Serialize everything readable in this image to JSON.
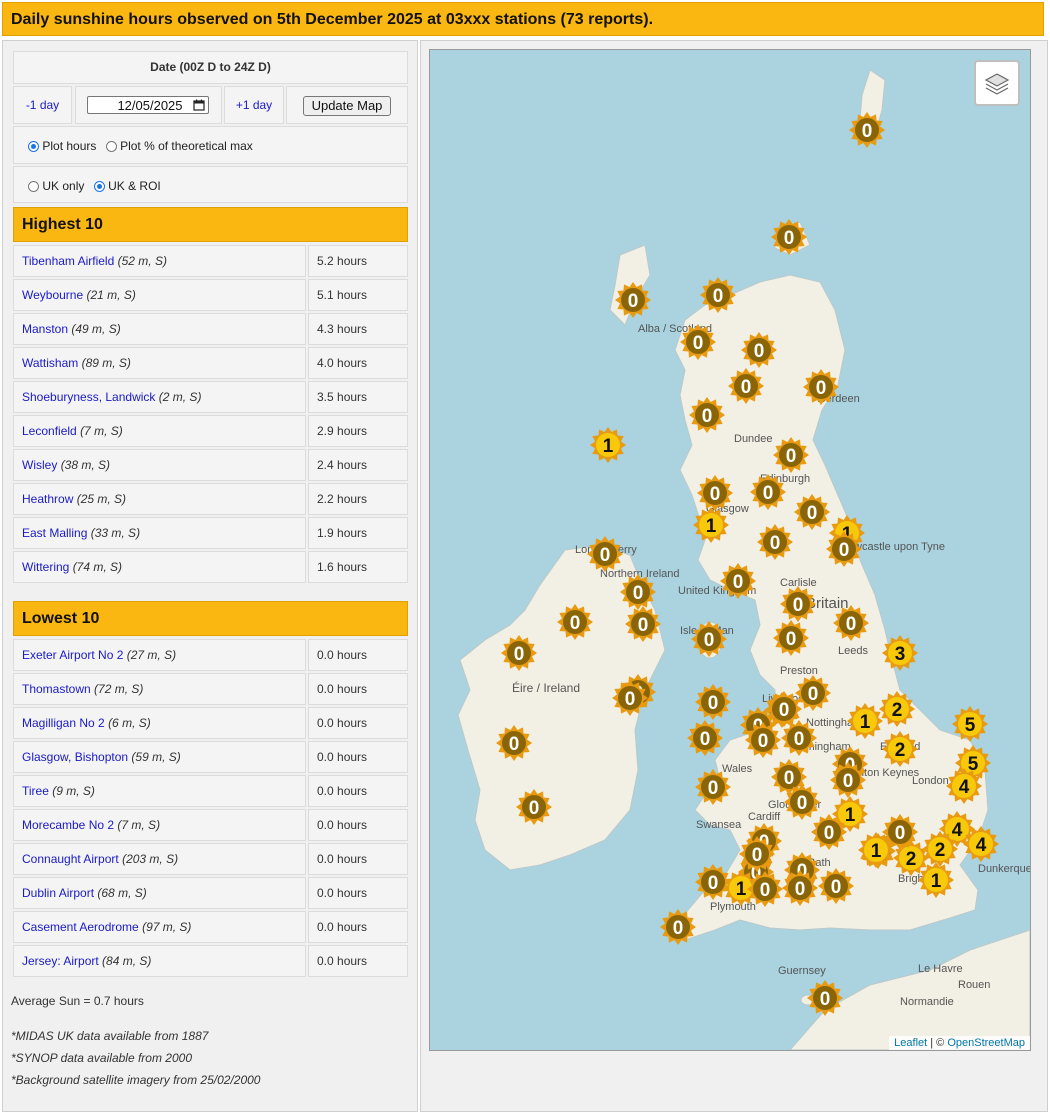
{
  "title": "Daily sunshine hours observed on 5th December 2025 at 03xxx stations (73 reports).",
  "controls": {
    "date_header": "Date (00Z D to 24Z D)",
    "prev_day": "-1 day",
    "date_value": "12/05/2025",
    "next_day": "+1 day",
    "update_button": "Update Map",
    "plot_hours": "Plot hours",
    "plot_percent": "Plot % of theoretical max",
    "plot_mode": "hours",
    "uk_only": "UK only",
    "uk_roi": "UK & ROI",
    "region_mode": "uk_roi"
  },
  "highest": {
    "heading": "Highest 10",
    "rows": [
      {
        "name": "Tibenham Airfield",
        "meta": "(52 m, S)",
        "value": "5.2 hours"
      },
      {
        "name": "Weybourne",
        "meta": "(21 m, S)",
        "value": "5.1 hours"
      },
      {
        "name": "Manston",
        "meta": "(49 m, S)",
        "value": "4.3 hours"
      },
      {
        "name": "Wattisham",
        "meta": "(89 m, S)",
        "value": "4.0 hours"
      },
      {
        "name": "Shoeburyness, Landwick",
        "meta": "(2 m, S)",
        "value": "3.5 hours"
      },
      {
        "name": "Leconfield",
        "meta": "(7 m, S)",
        "value": "2.9 hours"
      },
      {
        "name": "Wisley",
        "meta": "(38 m, S)",
        "value": "2.4 hours"
      },
      {
        "name": "Heathrow",
        "meta": "(25 m, S)",
        "value": "2.2 hours"
      },
      {
        "name": "East Malling",
        "meta": "(33 m, S)",
        "value": "1.9 hours"
      },
      {
        "name": "Wittering",
        "meta": "(74 m, S)",
        "value": "1.6 hours"
      }
    ]
  },
  "lowest": {
    "heading": "Lowest 10",
    "rows": [
      {
        "name": "Exeter Airport No 2",
        "meta": "(27 m, S)",
        "value": "0.0 hours"
      },
      {
        "name": "Thomastown",
        "meta": "(72 m, S)",
        "value": "0.0 hours"
      },
      {
        "name": "Magilligan No 2",
        "meta": "(6 m, S)",
        "value": "0.0 hours"
      },
      {
        "name": "Glasgow, Bishopton",
        "meta": "(59 m, S)",
        "value": "0.0 hours"
      },
      {
        "name": "Tiree",
        "meta": "(9 m, S)",
        "value": "0.0 hours"
      },
      {
        "name": "Morecambe No 2",
        "meta": "(7 m, S)",
        "value": "0.0 hours"
      },
      {
        "name": "Connaught Airport",
        "meta": "(203 m, S)",
        "value": "0.0 hours"
      },
      {
        "name": "Dublin Airport",
        "meta": "(68 m, S)",
        "value": "0.0 hours"
      },
      {
        "name": "Casement Aerodrome",
        "meta": "(97 m, S)",
        "value": "0.0 hours"
      },
      {
        "name": "Jersey: Airport",
        "meta": "(84 m, S)",
        "value": "0.0 hours"
      }
    ]
  },
  "average": "Average Sun = 0.7 hours",
  "notes": [
    "*MIDAS UK data available from 1887",
    "*SYNOP data available from 2000",
    "*Background satellite imagery from 25/02/2000"
  ],
  "map": {
    "place_labels": [
      "Britain",
      "Éire / Ireland",
      "United Kingdom",
      "Isle of Man",
      "Leeds",
      "Birmingham",
      "Cardiff",
      "Plymouth",
      "Guernsey",
      "Le Havre",
      "Rouen",
      "Normandie",
      "Dunkerque",
      "Newcastle upon Tyne",
      "Edinburgh",
      "Glasgow",
      "Carlisle",
      "Preston",
      "Swansea",
      "Bath",
      "Milton Keynes",
      "England",
      "Wales",
      "Aberdeen",
      "Dundee",
      "Londonderry",
      "Northern Ireland",
      "Alba / Scotland",
      "Nottingham",
      "Liverpool",
      "Gloucester",
      "London",
      "Brighton"
    ],
    "attribution_leaflet": "Leaflet",
    "attribution_sep": " | © ",
    "attribution_osm": "OpenStreetMap",
    "marker_colors": {
      "zero": "#8a6508",
      "nonzero": "#f7c90a",
      "ray": "#e89a10"
    },
    "markers": [
      0,
      0,
      0,
      0,
      0,
      0,
      0,
      0,
      0,
      1,
      0,
      0,
      0,
      0,
      1,
      1,
      0,
      0,
      0,
      0,
      0,
      0,
      0,
      0,
      0,
      0,
      0,
      3,
      0,
      0,
      0,
      0,
      0,
      0,
      1,
      2,
      5,
      0,
      0,
      0,
      0,
      0,
      2,
      5,
      0,
      0,
      0,
      4,
      0,
      0,
      1,
      0,
      0,
      0,
      4,
      4,
      0,
      0,
      2,
      1,
      2,
      1,
      0,
      0,
      0,
      1,
      0,
      0,
      0,
      0,
      0,
      0,
      0
    ]
  }
}
